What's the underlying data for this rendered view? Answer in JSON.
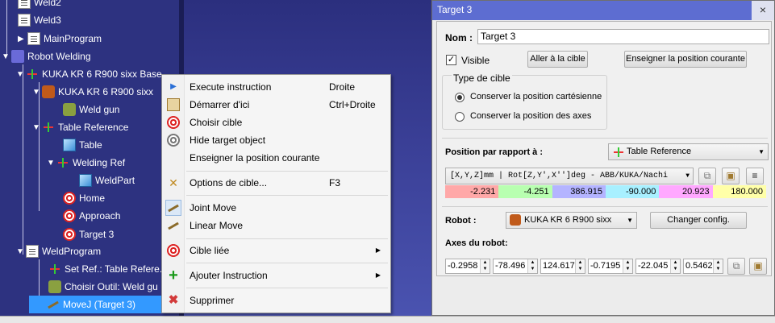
{
  "tree": {
    "items": [
      {
        "label": "Weld2",
        "icon": "document-icon"
      },
      {
        "label": "Weld3",
        "icon": "document-icon"
      },
      {
        "label": "MainProgram",
        "icon": "document-icon"
      },
      {
        "label": "Robot Welding",
        "icon": "robot-station-icon"
      },
      {
        "label": "KUKA KR 6 R900 sixx Base",
        "icon": "frame-icon"
      },
      {
        "label": "KUKA KR 6 R900 sixx",
        "icon": "robot-arm-icon"
      },
      {
        "label": "Weld gun",
        "icon": "weld-gun-icon"
      },
      {
        "label": "Table Reference",
        "icon": "frame-icon"
      },
      {
        "label": "Table",
        "icon": "cube-icon"
      },
      {
        "label": "Welding Ref",
        "icon": "frame-icon"
      },
      {
        "label": "WeldPart",
        "icon": "cube-icon"
      },
      {
        "label": "Home",
        "icon": "target-icon"
      },
      {
        "label": "Approach",
        "icon": "target-icon"
      },
      {
        "label": "Target 3",
        "icon": "target-icon"
      },
      {
        "label": "WeldProgram",
        "icon": "document-icon"
      },
      {
        "label": "Set Ref.: Table Refere...",
        "icon": "instruction-icon"
      },
      {
        "label": "Choisir Outil: Weld gu",
        "icon": "instruction-icon"
      },
      {
        "label": "MoveJ (Target 3)",
        "icon": "move-icon"
      }
    ]
  },
  "context_menu": {
    "items": [
      {
        "label": "Execute instruction",
        "shortcut": "Droite",
        "icon": "play-icon"
      },
      {
        "label": "Démarrer d'ici",
        "shortcut": "Ctrl+Droite",
        "icon": "start-here-icon"
      },
      {
        "label": "Choisir cible",
        "shortcut": "",
        "icon": "target-icon"
      },
      {
        "label": "Hide target object",
        "shortcut": "",
        "icon": "hide-target-icon"
      },
      {
        "label": "Enseigner la position courante",
        "shortcut": "",
        "icon": ""
      },
      {
        "label": "Options de cible...",
        "shortcut": "F3",
        "icon": "options-icon"
      },
      {
        "label": "Joint Move",
        "shortcut": "",
        "icon": "joint-move-icon",
        "checked": true
      },
      {
        "label": "Linear Move",
        "shortcut": "",
        "icon": "linear-move-icon"
      },
      {
        "label": "Cible liée",
        "shortcut": "",
        "icon": "linked-target-icon",
        "submenu": true
      },
      {
        "label": "Ajouter Instruction",
        "shortcut": "",
        "icon": "add-icon",
        "submenu": true
      },
      {
        "label": "Supprimer",
        "shortcut": "",
        "icon": "delete-icon"
      }
    ]
  },
  "panel": {
    "title": "Target 3",
    "close": "×",
    "name_label": "Nom :",
    "name_value": "Target 3",
    "visible_label": "Visible",
    "goto_button": "Aller à la cible",
    "teach_button": "Enseigner la position courante",
    "target_type_title": "Type de cible",
    "radio_cartesian": "Conserver la position cartésienne",
    "radio_axes": "Conserver la position des axes",
    "position_label": "Position par rapport à :",
    "reference_value": "Table Reference",
    "format_value": "[X,Y,Z]mm | Rot[Z,Y',X'']deg - ABB/KUKA/Nachi",
    "pose_values": [
      "-2.231",
      "-4.251",
      "386.915",
      "-90.000",
      "20.923",
      "180.000"
    ],
    "pose_colors": [
      "#ffa8a8",
      "#b8ffb0",
      "#b4b4ff",
      "#a8f0ff",
      "#ffa8ff",
      "#ffffa8"
    ],
    "robot_label": "Robot :",
    "robot_value": "KUKA KR 6 R900 sixx",
    "change_config_button": "Changer config.",
    "axes_label": "Axes du robot:",
    "joints": [
      "-0.2958",
      "-78.496",
      "124.617",
      "-0.7195",
      "-22.045",
      "0.5462"
    ]
  }
}
